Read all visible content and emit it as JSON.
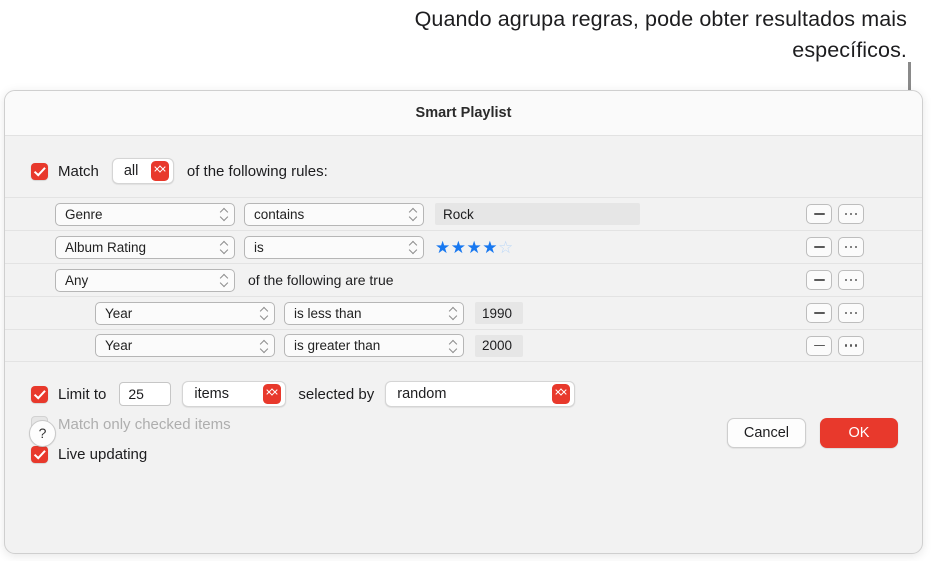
{
  "annotation": {
    "text": "Quando agrupa regras, pode obter resultados mais específicos."
  },
  "dialog": {
    "title": "Smart Playlist",
    "match": {
      "checkbox_checked": true,
      "label": "Match",
      "value": "all",
      "tail": "of the following rules:"
    },
    "rules": [
      {
        "field": "Genre",
        "operator": "contains",
        "value": "Rock",
        "value_type": "text",
        "nested": false,
        "remove_label": "remove-rule",
        "more_label": "more-options"
      },
      {
        "field": "Album Rating",
        "operator": "is",
        "value": "★★★★☆",
        "stars_filled": 4,
        "stars_total": 5,
        "value_type": "stars",
        "nested": false
      },
      {
        "field": "Any",
        "operator": "",
        "value": "of the following are true",
        "value_type": "group",
        "nested": false
      },
      {
        "field": "Year",
        "operator": "is less than",
        "value": "1990",
        "value_type": "number",
        "nested": true
      },
      {
        "field": "Year",
        "operator": "is greater than",
        "value": "2000",
        "value_type": "number",
        "nested": true
      }
    ],
    "options": {
      "limit": {
        "checked": true,
        "label": "Limit to",
        "count": "25",
        "unit": "items",
        "mid_text": "selected by",
        "selected_by": "random"
      },
      "match_checked": {
        "checked": true,
        "enabled": false,
        "label": "Match only checked items"
      },
      "live_updating": {
        "checked": true,
        "label": "Live updating"
      }
    },
    "footer": {
      "help": "?",
      "cancel": "Cancel",
      "ok": "OK"
    }
  },
  "colors": {
    "accent_red": "#e8392c",
    "star_blue": "#1878f0",
    "dialog_bg": "#f2f2f2",
    "callout_gray": "#8a8a8a"
  }
}
